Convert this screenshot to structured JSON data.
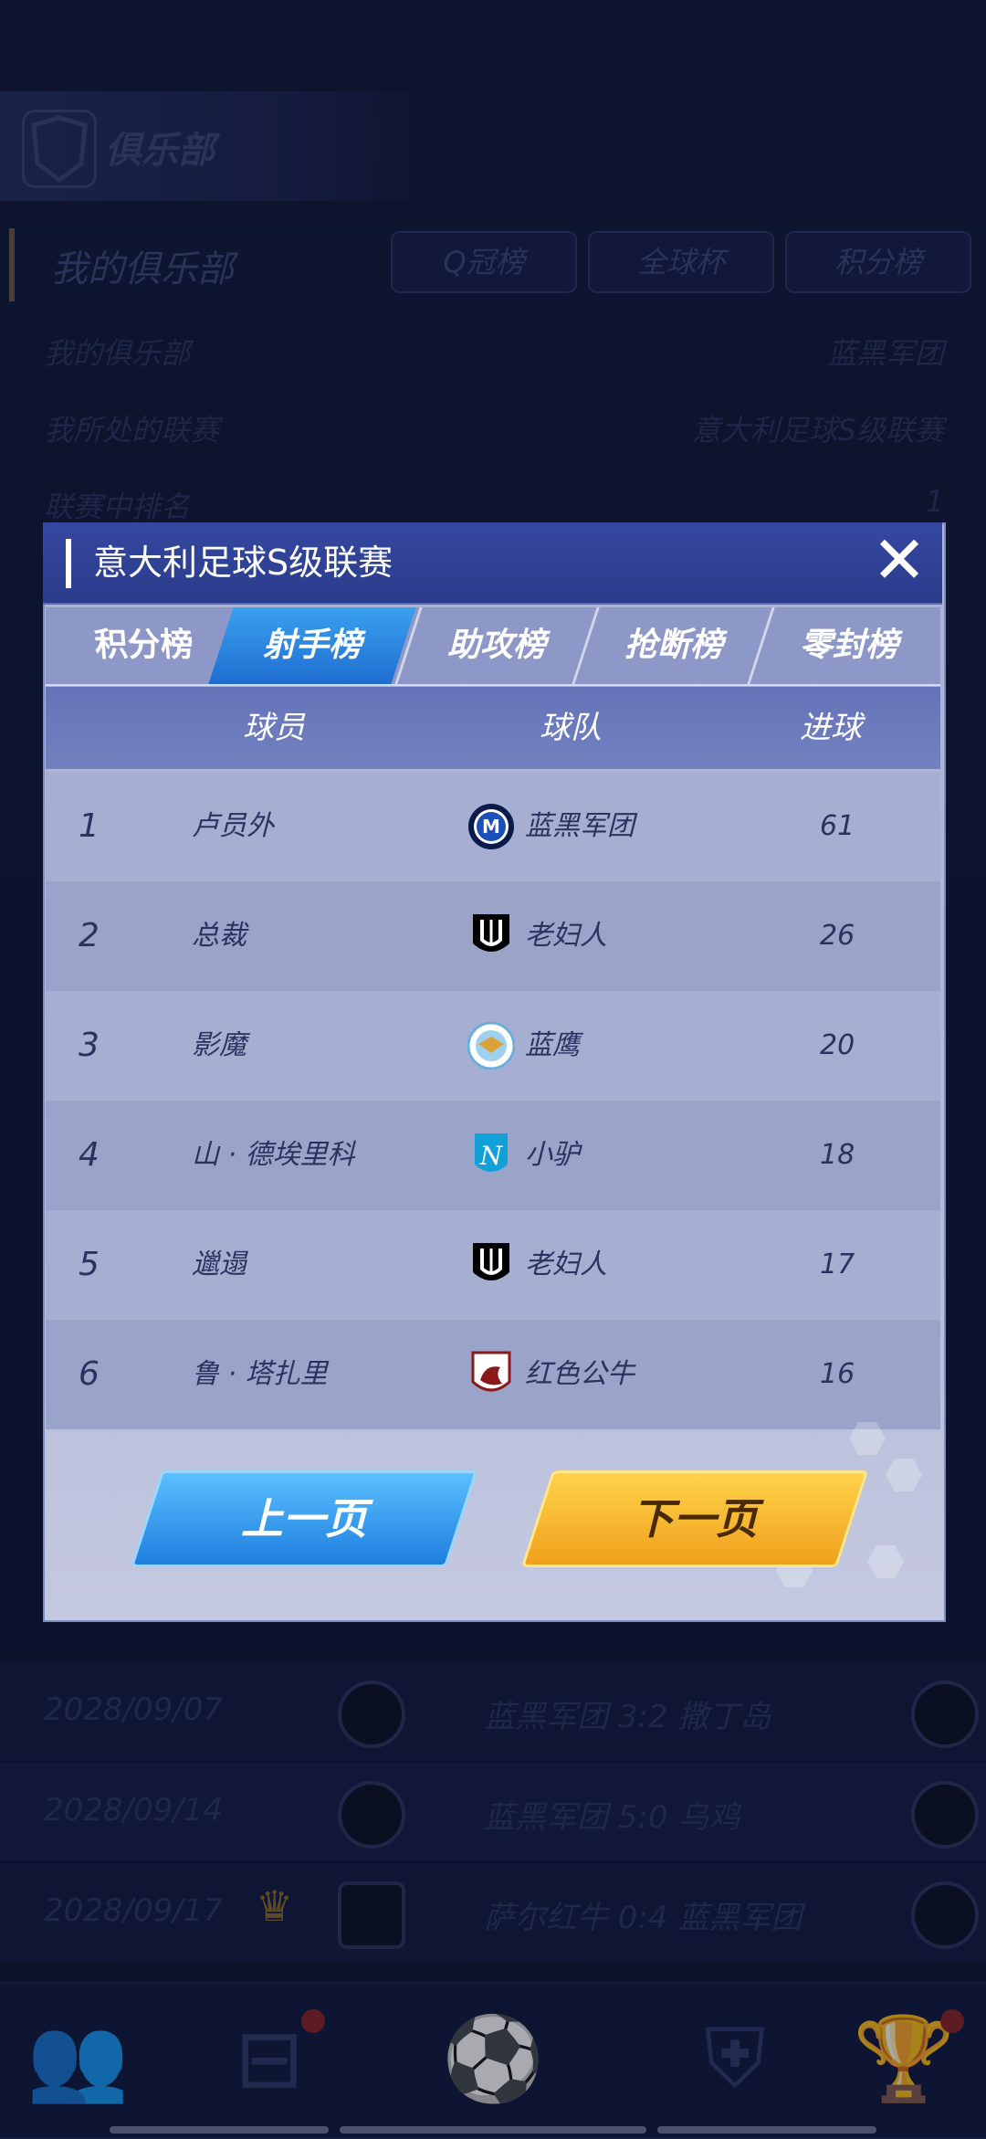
{
  "background": {
    "club_header": "俱乐部",
    "section_title": "我的俱乐部",
    "tabs": [
      "Q冠榜",
      "全球杯",
      "积分榜"
    ],
    "info": [
      {
        "label": "我的俱乐部",
        "value": "蓝黑军团"
      },
      {
        "label": "我所处的联赛",
        "value": "意大利足球S级联赛"
      },
      {
        "label": "联赛中排名",
        "value": "1"
      }
    ],
    "matches": [
      {
        "date": "2028/09/07",
        "text": "蓝黑军团  3:2  撒丁岛"
      },
      {
        "date": "2028/09/14",
        "text": "蓝黑军团  5:0  乌鸡"
      },
      {
        "date": "2028/09/17",
        "text": "萨尔红牛  0:4  蓝黑军团"
      }
    ]
  },
  "modal": {
    "title": "意大利足球S级联赛",
    "close_icon": "close-icon",
    "tabs": [
      {
        "label": "积分榜",
        "active": false
      },
      {
        "label": "射手榜",
        "active": true
      },
      {
        "label": "助攻榜",
        "active": false
      },
      {
        "label": "抢断榜",
        "active": false
      },
      {
        "label": "零封榜",
        "active": false
      }
    ],
    "headers": {
      "player": "球员",
      "team": "球队",
      "goals": "进球"
    },
    "rows": [
      {
        "rank": "1",
        "player": "卢员外",
        "team": "蓝黑军团",
        "logo": "inter-logo",
        "goals": "61"
      },
      {
        "rank": "2",
        "player": "总裁",
        "team": "老妇人",
        "logo": "juventus-logo",
        "goals": "26"
      },
      {
        "rank": "3",
        "player": "影魔",
        "team": "蓝鹰",
        "logo": "lazio-logo",
        "goals": "20"
      },
      {
        "rank": "4",
        "player": "山 · 德埃里科",
        "team": "小驴",
        "logo": "napoli-logo",
        "goals": "18"
      },
      {
        "rank": "5",
        "player": "邋遢",
        "team": "老妇人",
        "logo": "juventus-logo",
        "goals": "17"
      },
      {
        "rank": "6",
        "player": "鲁 · 塔扎里",
        "team": "红色公牛",
        "logo": "torino-logo",
        "goals": "16"
      }
    ],
    "prev_button": "上一页",
    "next_button": "下一页"
  },
  "colors": {
    "modal_header": "#2b3c8c",
    "active_tab": "#1f6ed0",
    "prev_button": "#1f7ee0",
    "next_button": "#f0a01c"
  }
}
